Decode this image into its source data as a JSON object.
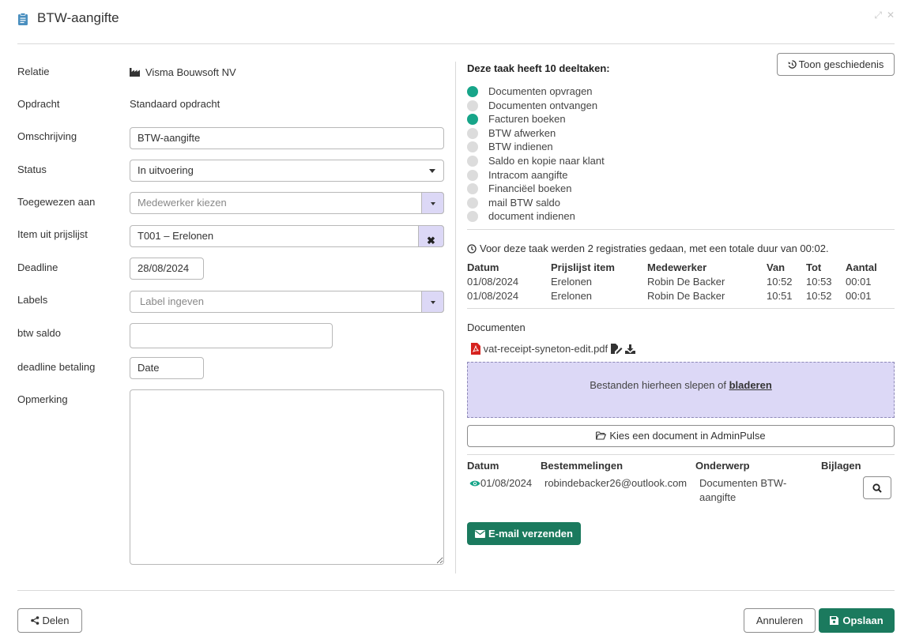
{
  "header": {
    "title": "BTW-aangifte",
    "expand_icon": "expand-icon",
    "close_icon": "close-icon"
  },
  "form": {
    "relatie": {
      "label": "Relatie",
      "value": "Visma Bouwsoft NV",
      "icon": "factory-icon"
    },
    "opdracht": {
      "label": "Opdracht",
      "value": "Standaard opdracht"
    },
    "omschrijving": {
      "label": "Omschrijving",
      "value": "BTW-aangifte"
    },
    "status": {
      "label": "Status",
      "value": "In uitvoering"
    },
    "toegewezen": {
      "label": "Toegewezen aan",
      "placeholder": "Medewerker kiezen"
    },
    "item": {
      "label": "Item uit prijslijst",
      "value": "T001 – Erelonen"
    },
    "deadline": {
      "label": "Deadline",
      "value": "28/08/2024"
    },
    "labels": {
      "label": "Labels",
      "placeholder": "Label ingeven"
    },
    "btw_saldo": {
      "label": "btw saldo",
      "value": ""
    },
    "deadline_betaling": {
      "label": "deadline betaling",
      "value": "Date"
    },
    "opmerking": {
      "label": "Opmerking",
      "value": ""
    }
  },
  "subtasks": {
    "title": "Deze taak heeft 10 deeltaken:",
    "history_button": "Toon geschiedenis",
    "done_color": "#17a589",
    "todo_color": "#dcdcdc",
    "items": [
      {
        "label": "Documenten opvragen",
        "done": true
      },
      {
        "label": "Documenten ontvangen",
        "done": false
      },
      {
        "label": "Facturen boeken",
        "done": true
      },
      {
        "label": "BTW afwerken",
        "done": false
      },
      {
        "label": "BTW indienen",
        "done": false
      },
      {
        "label": "Saldo en kopie naar klant",
        "done": false
      },
      {
        "label": "Intracom aangifte",
        "done": false
      },
      {
        "label": "Financiëel boeken",
        "done": false
      },
      {
        "label": "mail BTW saldo",
        "done": false
      },
      {
        "label": "document indienen",
        "done": false
      }
    ]
  },
  "registrations": {
    "summary": "Voor deze taak werden 2 registraties gedaan, met een totale duur van 00:02.",
    "headers": [
      "Datum",
      "Prijslijst item",
      "Medewerker",
      "Van",
      "Tot",
      "Aantal"
    ],
    "rows": [
      [
        "01/08/2024",
        "Erelonen",
        "Robin De Backer",
        "10:52",
        "10:53",
        "00:01"
      ],
      [
        "01/08/2024",
        "Erelonen",
        "Robin De Backer",
        "10:51",
        "10:52",
        "00:01"
      ]
    ]
  },
  "documents": {
    "title": "Documenten",
    "file_name": "vat-receipt-syneton-edit.pdf",
    "dropzone_text": "Bestanden hierheen slepen of",
    "dropzone_link": "bladeren",
    "adminpulse_button": "Kies een document in AdminPulse"
  },
  "emails": {
    "headers": [
      "Datum",
      "Bestemmelingen",
      "Onderwerp",
      "Bijlagen"
    ],
    "row": {
      "date": "01/08/2024",
      "recipient": "robindebacker26@outlook.com",
      "subject_line1": "Documenten BTW-",
      "subject_line2": "aangifte"
    },
    "send_button": "E-mail verzenden"
  },
  "footer": {
    "share": "Delen",
    "cancel": "Annuleren",
    "save": "Opslaan"
  }
}
